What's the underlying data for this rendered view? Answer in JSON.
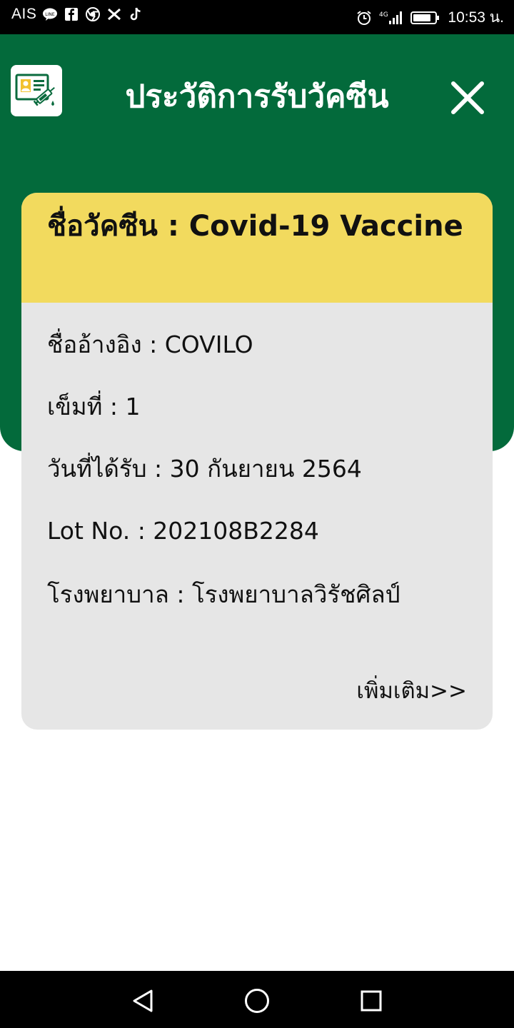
{
  "status_bar": {
    "carrier": "AIS",
    "time": "10:53 น.",
    "network": "4G",
    "notification_icons": [
      "line-icon",
      "facebook-icon",
      "chrome-icon",
      "app-icon",
      "tiktok-icon"
    ],
    "system_icons": [
      "alarm-icon",
      "signal-icon",
      "battery-icon"
    ]
  },
  "header": {
    "title": "ประวัติการรับวัคซีน",
    "app_icon": "vaccine-certificate-icon",
    "close_icon": "close-icon",
    "background_color": "#036A3B"
  },
  "card": {
    "title_label": "ชื่อวัคซีน",
    "title_sep": " : ",
    "title_value": "Covid-19 Vaccine",
    "header_color": "#F2DA5E",
    "body_color": "#E6E6E6",
    "ref_name": "ชื่ออ้างอิง : COVILO",
    "dose": "เข็มที่ : 1",
    "date_received": "วันที่ได้รับ : 30 กันยายน 2564",
    "lot_no": "Lot No. : 202108B2284",
    "hospital": "โรงพยาบาล : โรงพยาบาลวิรัชศิลป์",
    "more_label": "เพิ่มเติม>>"
  },
  "nav_bar": {
    "back_icon": "back-triangle-icon",
    "home_icon": "home-circle-icon",
    "recents_icon": "recents-square-icon"
  }
}
